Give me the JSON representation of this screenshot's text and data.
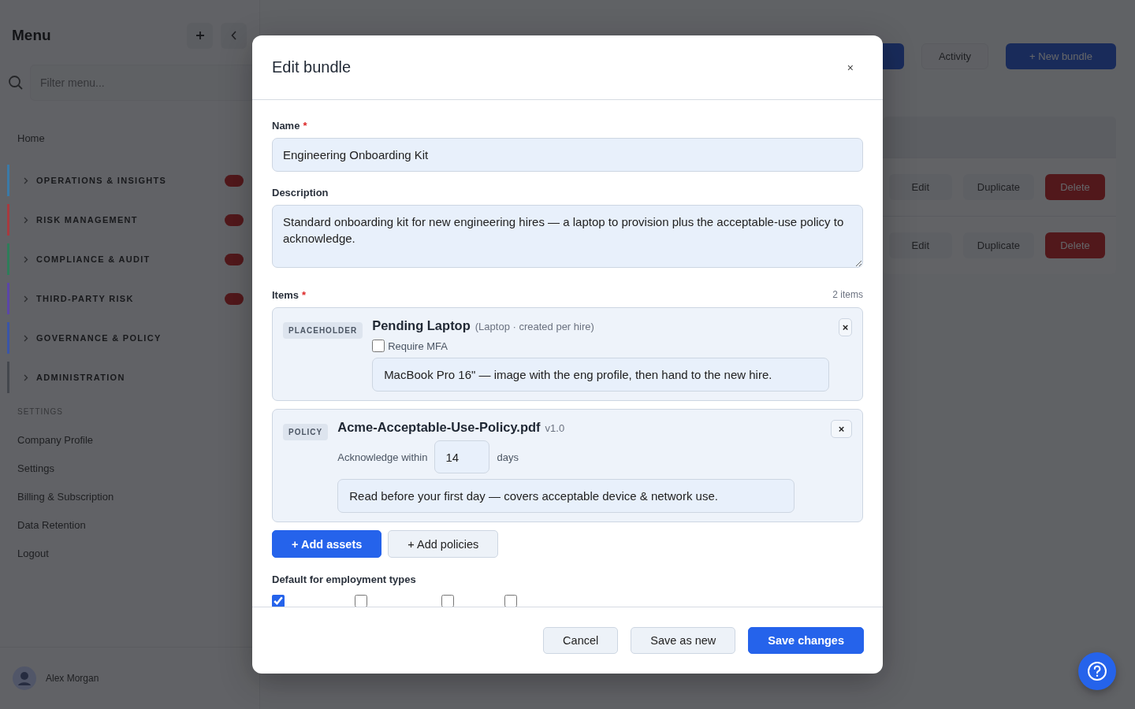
{
  "sidebar": {
    "title": "Menu",
    "filter": {
      "placeholder": "Filter menu..."
    },
    "home": "Home",
    "groups": [
      {
        "label": "OPERATIONS & INSIGHTS",
        "color": "#3a7aa8",
        "badge": true
      },
      {
        "label": "RISK MANAGEMENT",
        "color": "#a83a3f",
        "badge": true
      },
      {
        "label": "COMPLIANCE & AUDIT",
        "color": "#2e7d5a",
        "badge": true
      },
      {
        "label": "THIRD-PARTY RISK",
        "color": "#5b46a8",
        "badge": true
      },
      {
        "label": "GOVERNANCE & POLICY",
        "color": "#3a55a8",
        "badge": false
      },
      {
        "label": "ADMINISTRATION",
        "color": "#44474d",
        "badge": false
      }
    ],
    "settings_heading": "SETTINGS",
    "links": [
      "Company Profile",
      "Settings",
      "Billing & Subscription",
      "Data Retention",
      "Logout"
    ],
    "user": {
      "name": "Alex Morgan"
    }
  },
  "main": {
    "toolbar": [
      {
        "kind": "primary"
      },
      {
        "label": "Activity",
        "kind": "secondary"
      },
      {
        "label": "+ New bundle",
        "kind": "primary"
      }
    ],
    "rows": [
      {
        "actions": [
          "Edit",
          "Duplicate",
          "Delete"
        ]
      },
      {
        "actions": [
          "Edit",
          "Duplicate",
          "Delete"
        ]
      }
    ]
  },
  "modal": {
    "title": "Edit bundle",
    "close": "×",
    "name": {
      "label": "Name",
      "required_mark": "*",
      "value": "Engineering Onboarding Kit"
    },
    "description": {
      "label": "Description",
      "value": "Standard onboarding kit for new engineering hires — a laptop to provision plus the acceptable-use policy to acknowledge."
    },
    "items_section": {
      "label": "Items",
      "required_mark": "*",
      "count": "2 items"
    },
    "items": [
      {
        "kind": "placeholder",
        "badge": "PLACEHOLDER",
        "title": "Pending Laptop",
        "meta": "(Laptop · created per hire)",
        "remove": "×",
        "mfa": {
          "label": "Require MFA",
          "checked": false
        },
        "note": "MacBook Pro 16\" — image with the eng profile, then hand to the new hire."
      },
      {
        "kind": "policy",
        "badge": "POLICY",
        "title": "Acme-Acceptable-Use-Policy.pdf",
        "meta": "v1.0",
        "remove": "×",
        "ack": {
          "before": "Acknowledge within",
          "value": "14",
          "after": "days"
        },
        "note": "Read before your first day — covers acceptable device & network use."
      }
    ],
    "add_buttons": [
      {
        "label": "+ Add assets",
        "kind": "primary"
      },
      {
        "label": "+ Add policies",
        "kind": "secondary"
      }
    ],
    "employment_types": {
      "label": "Default for employment types",
      "options": [
        {
          "checked": true
        },
        {
          "checked": false
        },
        {
          "checked": false
        },
        {
          "checked": false
        }
      ]
    },
    "footer": [
      {
        "label": "Cancel",
        "kind": "secondary"
      },
      {
        "label": "Save as new",
        "kind": "secondary"
      },
      {
        "label": "Save changes",
        "kind": "primary"
      }
    ]
  }
}
